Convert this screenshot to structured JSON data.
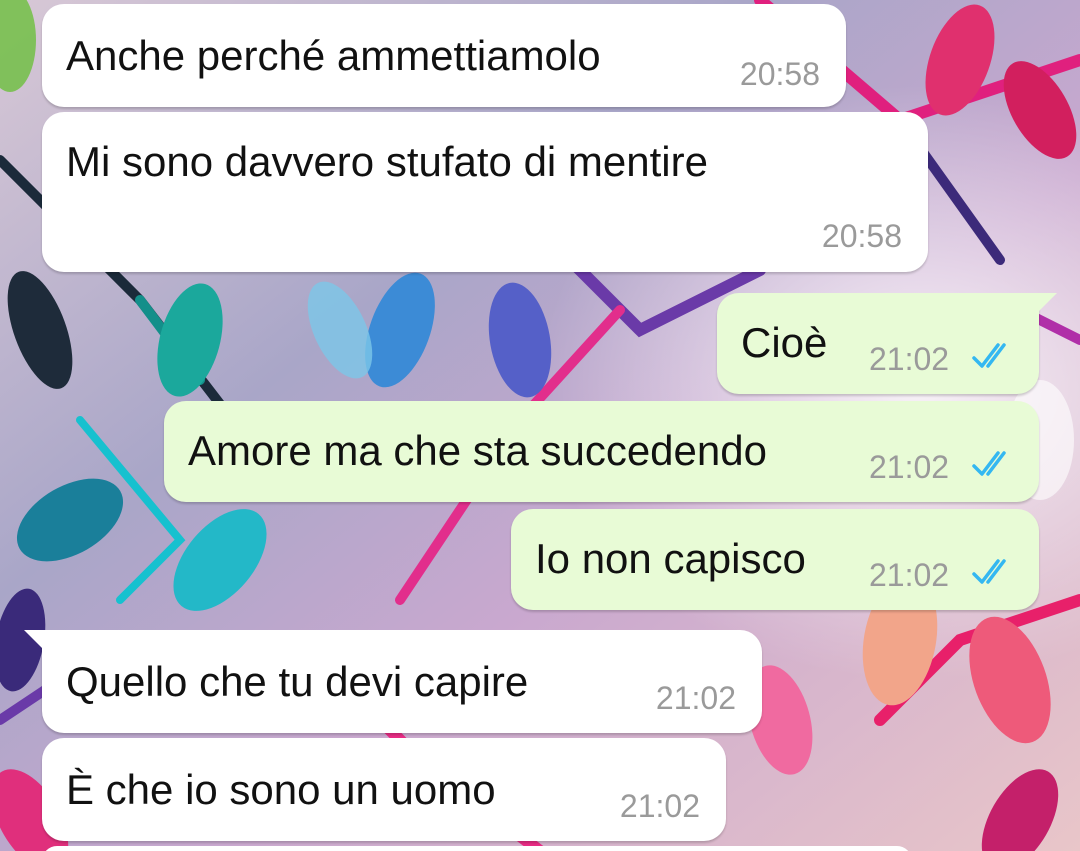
{
  "colors": {
    "incoming_bubble": "#ffffff",
    "outgoing_bubble": "#e8fbd6",
    "timestamp": "#9a9a9a",
    "read_ticks": "#34b7f1"
  },
  "messages": [
    {
      "direction": "incoming",
      "text": "Anche perché ammettiamolo",
      "time": "20:58"
    },
    {
      "direction": "incoming",
      "text": "Mi sono davvero stufato di mentire",
      "time": "20:58"
    },
    {
      "direction": "outgoing",
      "text": "Cioè",
      "time": "21:02",
      "status_icon": "double-check-read-icon"
    },
    {
      "direction": "outgoing",
      "text": "Amore ma che sta succedendo",
      "time": "21:02",
      "status_icon": "double-check-read-icon"
    },
    {
      "direction": "outgoing",
      "text": "Io non capisco",
      "time": "21:02",
      "status_icon": "double-check-read-icon"
    },
    {
      "direction": "incoming",
      "text": "Quello che tu devi capire",
      "time": "21:02"
    },
    {
      "direction": "incoming",
      "text": "È che io sono un uomo",
      "time": "21:02"
    }
  ]
}
